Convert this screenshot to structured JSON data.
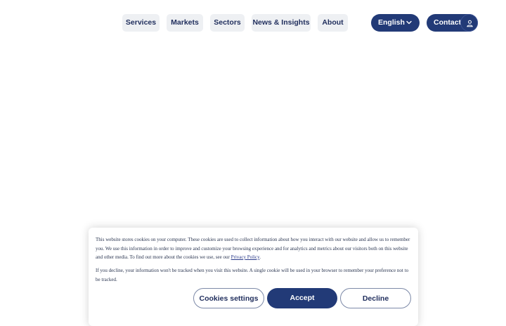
{
  "nav": {
    "items": [
      {
        "label": "Services"
      },
      {
        "label": "Markets"
      },
      {
        "label": "Sectors"
      },
      {
        "label": "News & Insights"
      },
      {
        "label": "About"
      }
    ],
    "language": {
      "label": "English",
      "icon": "chevron-down-icon"
    },
    "contact": {
      "label": "Contact",
      "icon": "user-icon"
    }
  },
  "cookie_banner": {
    "paragraph1": "This website stores cookies on your computer. These cookies are used to collect information about how you interact with our website and allow us to remember you. We use this information in order to improve and customize your browsing experience and for analytics and metrics about our visitors both on this website and other media. To find out more about the cookies we use, see our",
    "privacy_link": "Privacy Policy",
    "paragraph1_end": ".",
    "paragraph2": "If you decline, your information won't be tracked when you visit this website. A single cookie will be used in your browser to remember your preference not to be tracked.",
    "buttons": {
      "settings": "Cookies settings",
      "accept": "Accept",
      "decline": "Decline"
    }
  },
  "colors": {
    "brand_navy": "#223a77",
    "nav_pill_bg": "#eef0f3",
    "text_navy": "#1f2d5c"
  }
}
